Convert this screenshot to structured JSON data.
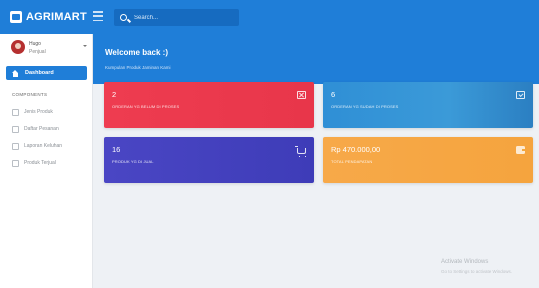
{
  "header": {
    "brand": "AGRIMART",
    "search_placeholder": "Search..."
  },
  "sidebar": {
    "user_name": "Hugo",
    "user_role": "Penjual",
    "dashboard_label": "Dashboard",
    "section_label": "COMPONENTS",
    "items": [
      {
        "label": "Jenis Produk",
        "icon": "tag-icon"
      },
      {
        "label": "Daftar Pesanan",
        "icon": "list-icon"
      },
      {
        "label": "Laporan Keluhan",
        "icon": "report-icon"
      },
      {
        "label": "Produk Terjual",
        "icon": "sold-icon"
      }
    ]
  },
  "banner": {
    "title": "Welcome back :)",
    "subtitle": "Kumpulan Produk Jaminan Kami"
  },
  "cards": [
    {
      "value": "2",
      "label": "ORDERAN YG BELUM DI PROSES",
      "color": "#ee3c50",
      "icon": "close-box-icon"
    },
    {
      "value": "6",
      "label": "ORDERAN YG SUDAH DI PROSES",
      "color": "#2f8fd6",
      "icon": "check-box-icon"
    },
    {
      "value": "16",
      "label": "PRODUK YG DI JUAL",
      "color": "#4a46c4",
      "icon": "cart-icon"
    },
    {
      "value": "Rp 470.000,00",
      "label": "TOTAL PENDAPATAN",
      "color": "#f7a949",
      "icon": "wallet-icon"
    }
  ],
  "watermark": {
    "title": "Activate Windows",
    "subtitle": "Go to Settings to activate Windows."
  }
}
